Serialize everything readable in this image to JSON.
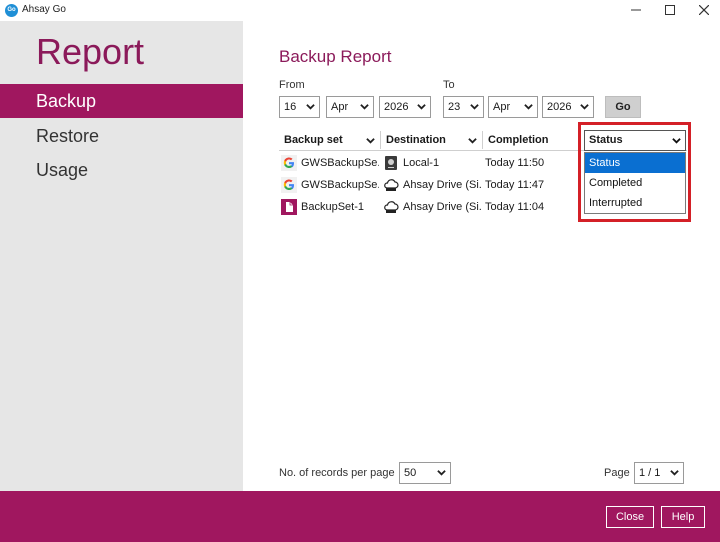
{
  "window": {
    "app_icon_text": "Go",
    "title": "Ahsay Go"
  },
  "sidebar": {
    "title": "Report",
    "items": [
      {
        "label": "Backup"
      },
      {
        "label": "Restore"
      },
      {
        "label": "Usage"
      }
    ]
  },
  "main": {
    "title": "Backup Report",
    "from_label": "From",
    "to_label": "To",
    "from": {
      "day": "16",
      "month": "Apr",
      "year": "2026"
    },
    "to": {
      "day": "23",
      "month": "Apr",
      "year": "2026"
    },
    "go_label": "Go"
  },
  "table": {
    "headers": [
      "Backup set",
      "Destination",
      "Completion"
    ],
    "rows": [
      {
        "backup_set": "GWSBackupSe...",
        "set_icon": "google-icon",
        "destination": "Local-1",
        "dest_icon": "local-drive-icon",
        "completion": "Today 11:50"
      },
      {
        "backup_set": "GWSBackupSe...",
        "set_icon": "google-icon",
        "destination": "Ahsay Drive (Si...",
        "dest_icon": "cloud-drive-icon",
        "completion": "Today 11:47"
      },
      {
        "backup_set": "BackupSet-1",
        "set_icon": "file-icon",
        "destination": "Ahsay Drive (Si...",
        "dest_icon": "cloud-drive-icon",
        "completion": "Today 11:04"
      }
    ]
  },
  "status_filter": {
    "selected": "Status",
    "options": [
      "Status",
      "Completed",
      "Interrupted"
    ],
    "highlighted_index": 0
  },
  "footer": {
    "records_label": "No. of records per page",
    "records_value": "50",
    "page_label": "Page",
    "page_value": "1 / 1"
  },
  "buttons": {
    "close": "Close",
    "help": "Help"
  },
  "colors": {
    "brand": "#a0175f",
    "title": "#8b1a5a",
    "highlight": "#0a6fd1",
    "annotation": "#d42027"
  }
}
